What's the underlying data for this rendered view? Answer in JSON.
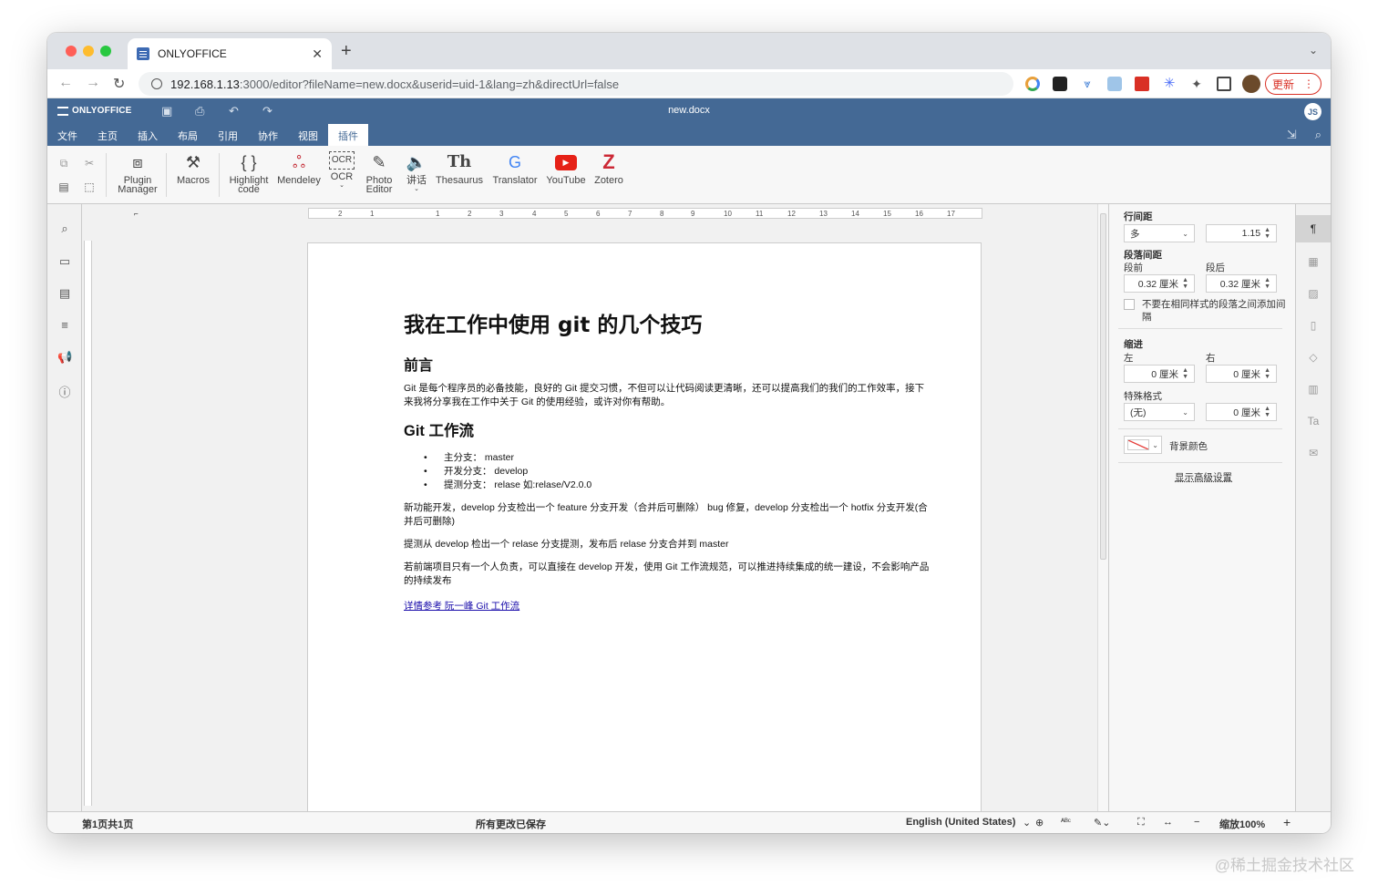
{
  "browser": {
    "tab_title": "ONLYOFFICE",
    "url_host": "192.168.1.13",
    "url_path": ":3000/editor?fileName=new.docx&userid=uid-1&lang=zh&directUrl=false",
    "update_label": "更新"
  },
  "editor": {
    "logo": "ONLYOFFICE",
    "doc_name": "new.docx",
    "avatar_initials": "JS",
    "menu": [
      "文件",
      "主页",
      "插入",
      "布局",
      "引用",
      "协作",
      "视图",
      "插件"
    ],
    "active_menu": "插件"
  },
  "toolbar": {
    "plugin_manager": "Plugin\nManager",
    "macros": "Macros",
    "highlight_code": "Highlight\ncode",
    "mendeley": "Mendeley",
    "ocr": "OCR",
    "photo_editor": "Photo\nEditor",
    "speech": "讲话",
    "thesaurus": "Thesaurus",
    "translator": "Translator",
    "youtube": "YouTube",
    "zotero": "Zotero"
  },
  "ruler": {
    "h_numbers": [
      "2",
      "1",
      "1",
      "2",
      "3",
      "4",
      "5",
      "6",
      "7",
      "8",
      "9",
      "10",
      "11",
      "12",
      "13",
      "14",
      "15",
      "16",
      "17"
    ]
  },
  "document": {
    "title": "我在工作中使用 git 的几个技巧",
    "section1_heading": "前言",
    "section1_para": "Git 是每个程序员的必备技能，良好的 Git 提交习惯，不但可以让代码阅读更清晰，还可以提高我们的我们的工作效率，接下来我将分享我在工作中关于 Git 的使用经验，或许对你有帮助。",
    "section2_heading": "Git 工作流",
    "bullets": [
      "主分支： master",
      "开发分支： develop",
      "提测分支： relase 如:relase/V2.0.0"
    ],
    "para2": "新功能开发，develop 分支检出一个 feature 分支开发（合并后可删除） bug 修复，develop 分支检出一个 hotfix 分支开发(合并后可删除)",
    "para3": "提测从 develop 检出一个 relase 分支提测，发布后 relase 分支合并到 master",
    "para4": "若前端项目只有一个人负责，可以直接在 develop 开发，使用 Git 工作流规范，可以推进持续集成的统一建设，不会影响产品的持续发布",
    "link_text": "详情参考 阮一峰 Git 工作流"
  },
  "right_panel": {
    "line_spacing_label": "行间距",
    "line_spacing_type": "多",
    "line_spacing_value": "1.15",
    "para_spacing_label": "段落间距",
    "before_label": "段前",
    "after_label": "段后",
    "before_value": "0.32 厘米",
    "after_value": "0.32 厘米",
    "no_space_label": "不要在相同样式的段落之间添加间隔",
    "indent_label": "缩进",
    "left_label": "左",
    "right_label": "右",
    "left_value": "0 厘米",
    "right_value": "0 厘米",
    "special_label": "特殊格式",
    "special_value": "(无)",
    "special_amount": "0 厘米",
    "bg_color_label": "背景颜色",
    "advanced_label": "显示高级设置"
  },
  "status": {
    "page_info": "第1页共1页",
    "save_state": "所有更改已保存",
    "language": "English (United States)",
    "zoom": "缩放100%"
  },
  "watermark": "@稀土掘金技术社区",
  "colors": {
    "header_blue": "#446995",
    "youtube_red": "#e62117",
    "zotero_red": "#cc2936",
    "link_blue": "#1a0dab"
  }
}
